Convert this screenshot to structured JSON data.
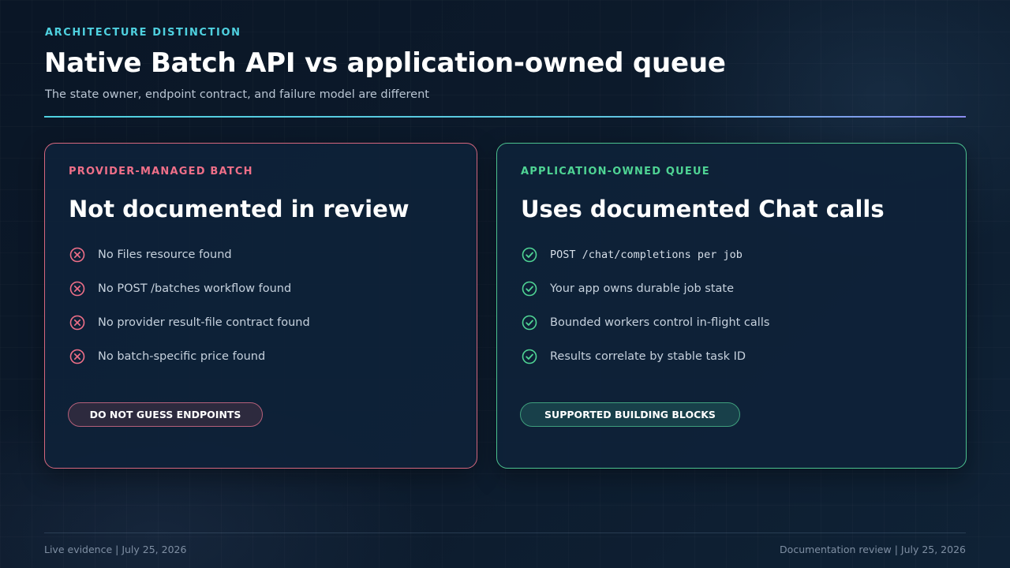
{
  "header": {
    "eyebrow": "ARCHITECTURE DISTINCTION",
    "title": "Native Batch API vs application-owned queue",
    "subtitle": "The state owner, endpoint contract, and failure model are different"
  },
  "cards": {
    "left": {
      "label": "PROVIDER-MANAGED BATCH",
      "heading": "Not documented in review",
      "icon": "x-circle-icon",
      "accent": "#d5677e",
      "items": [
        "No Files resource found",
        "No POST /batches workflow found",
        "No provider result-file contract found",
        "No batch-specific price found"
      ],
      "pill": "DO NOT GUESS ENDPOINTS"
    },
    "right": {
      "label": "APPLICATION-OWNED QUEUE",
      "heading": "Uses documented Chat calls",
      "icon": "check-circle-icon",
      "accent": "#4cc28f",
      "items": [
        "POST /chat/completions per job",
        "Your app owns durable job state",
        "Bounded workers control in-flight calls",
        "Results correlate by stable task ID"
      ],
      "pill": "SUPPORTED BUILDING BLOCKS"
    }
  },
  "footer": {
    "left": "Live evidence | July 25, 2026",
    "right": "Documentation review | July 25, 2026"
  },
  "colors": {
    "accent_cyan": "#4fd1e0",
    "negative": "#ef6f88",
    "positive": "#4fd494",
    "background": "#0c1a2b"
  }
}
